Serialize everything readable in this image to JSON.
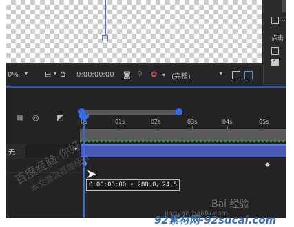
{
  "viewer": {
    "zoom_percent": "0%",
    "timecode": "0:00:00:00",
    "quality": "(完整)"
  },
  "right_panel": {
    "label": "点击"
  },
  "timeline": {
    "layer_mode": "无",
    "ruler_ticks": [
      "0s",
      "01s",
      "02s",
      "03s",
      "04s",
      "05s"
    ]
  },
  "tooltip": {
    "text": "0:00:00:00 • 288.0，24.5"
  },
  "watermarks": {
    "wm1": "百度经验·你好",
    "wm2": "本文源自百度经验",
    "baidu": "Bai 经验",
    "site": "jingyan.baidu.com",
    "footer": "92素材网-92sucai.com"
  }
}
